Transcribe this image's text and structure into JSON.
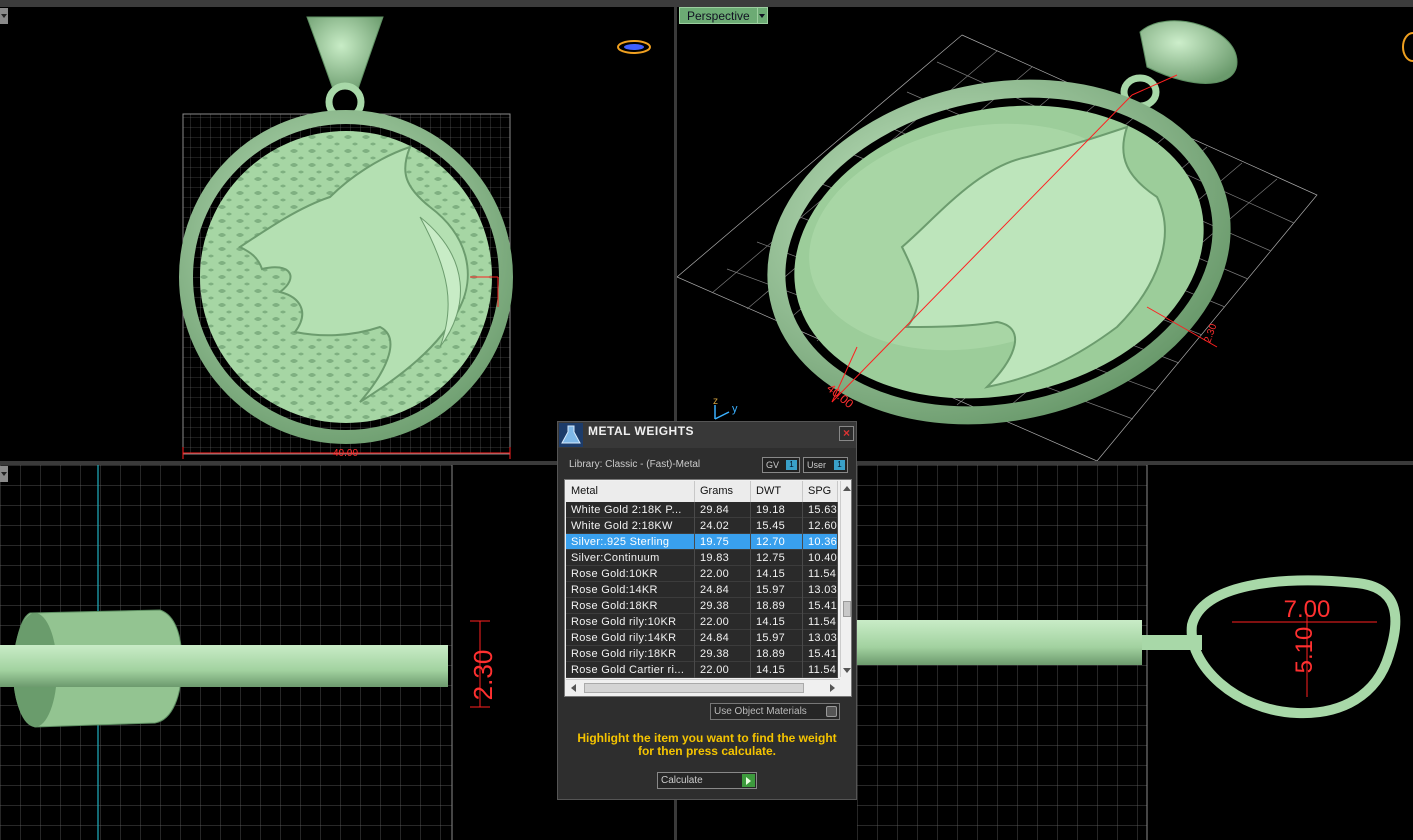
{
  "viewports": {
    "top_left": {
      "dimension_label": "40.00"
    },
    "top_right": {
      "view_label": "Perspective",
      "dimension_label": "40.00",
      "depth_label": "2.30",
      "axis_z": "z",
      "axis_y": "y"
    },
    "bottom_left": {
      "dimension_label": "2.30"
    },
    "bottom_right": {
      "width_label": "7.00",
      "height_label": "5.10"
    }
  },
  "dialog": {
    "title": "METAL WEIGHTS",
    "library_label": "Library: Classic - (Fast)-Metal",
    "toggle_gv": {
      "label": "GV",
      "value": "1"
    },
    "toggle_user": {
      "label": "User",
      "value": "1"
    },
    "columns": {
      "metal": "Metal",
      "grams": "Grams",
      "dwt": "DWT",
      "spg": "SPG"
    },
    "rows": [
      {
        "metal": "White Gold 2:18K P...",
        "grams": "29.84",
        "dwt": "19.18",
        "spg": "15.63"
      },
      {
        "metal": "White Gold 2:18KW",
        "grams": "24.02",
        "dwt": "15.45",
        "spg": "12.60"
      },
      {
        "metal": "Silver:.925 Sterling",
        "grams": "19.75",
        "dwt": "12.70",
        "spg": "10.36"
      },
      {
        "metal": "Silver:Continuum",
        "grams": "19.83",
        "dwt": "12.75",
        "spg": "10.40"
      },
      {
        "metal": "Rose Gold:10KR",
        "grams": "22.00",
        "dwt": "14.15",
        "spg": "11.54"
      },
      {
        "metal": "Rose Gold:14KR",
        "grams": "24.84",
        "dwt": "15.97",
        "spg": "13.03"
      },
      {
        "metal": "Rose Gold:18KR",
        "grams": "29.38",
        "dwt": "18.89",
        "spg": "15.41"
      },
      {
        "metal": "Rose Gold rily:10KR",
        "grams": "22.00",
        "dwt": "14.15",
        "spg": "11.54"
      },
      {
        "metal": "Rose Gold rily:14KR",
        "grams": "24.84",
        "dwt": "15.97",
        "spg": "13.03"
      },
      {
        "metal": "Rose Gold rily:18KR",
        "grams": "29.38",
        "dwt": "18.89",
        "spg": "15.41"
      },
      {
        "metal": "Rose Gold Cartier ri...",
        "grams": "22.00",
        "dwt": "14.15",
        "spg": "11.54"
      }
    ],
    "selected_row": 2,
    "use_object_materials": "Use Object Materials",
    "hint": "Highlight the item you want to find the weight for then press calculate.",
    "calculate_label": "Calculate"
  },
  "colors": {
    "model": "#a8d8a8",
    "model_dark": "#5e8f62",
    "dimension": "#ff2020",
    "grid": "#6e6e6e",
    "selection": "#39a0ee",
    "hint_text": "#f5c400"
  }
}
